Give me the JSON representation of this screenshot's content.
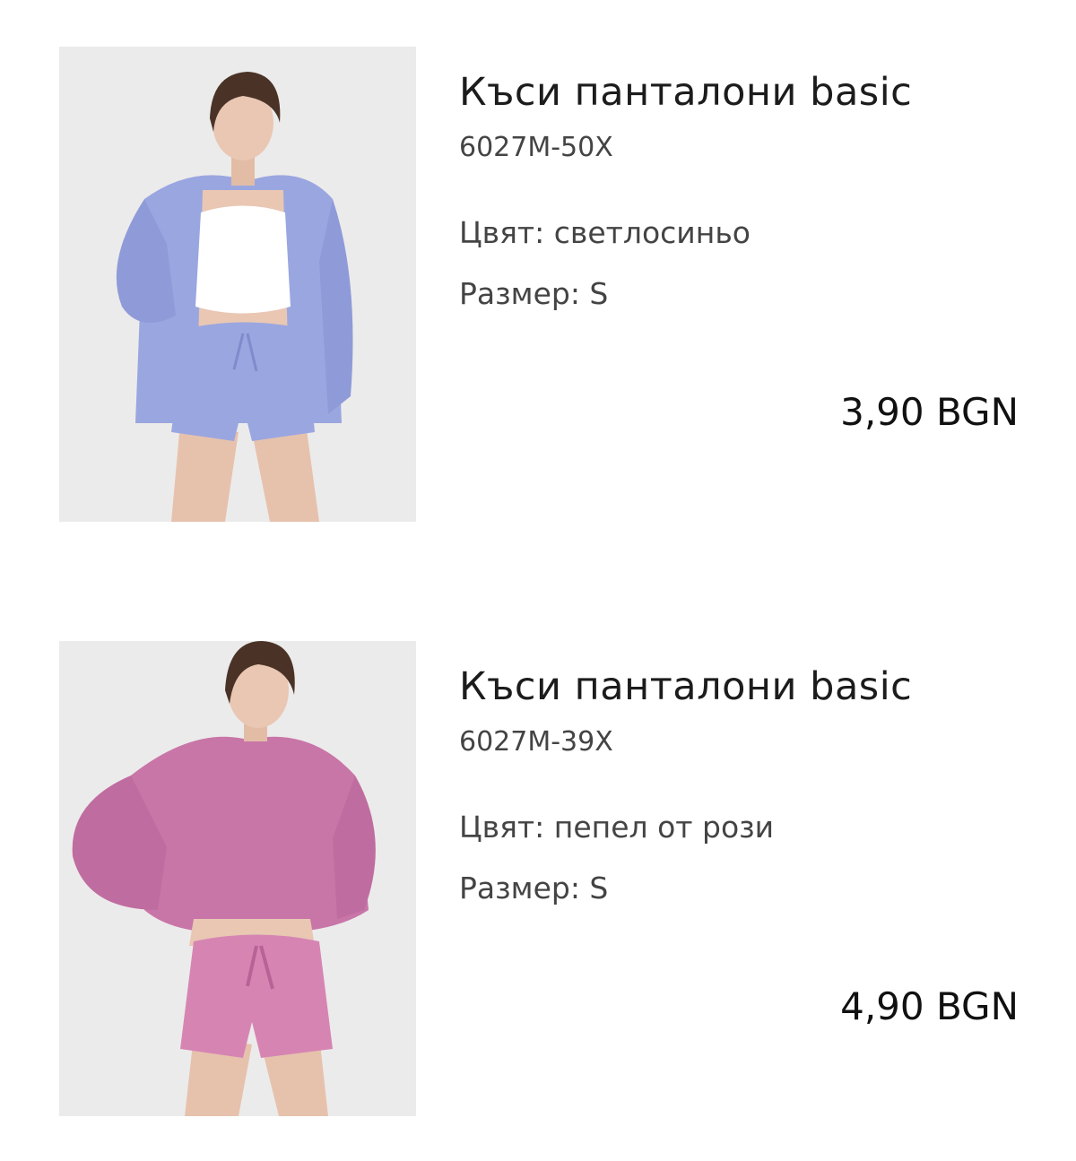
{
  "items": [
    {
      "title": "Къси панталони basic",
      "sku": "6027M-50X",
      "color_line": "Цвят: светлосиньо",
      "size_line": "Размер: S",
      "price": "3,90 BGN",
      "garment_color": "#9aa6e0"
    },
    {
      "title": "Къси панталони basic",
      "sku": "6027M-39X",
      "color_line": "Цвят: пепел от рози",
      "size_line": "Размер: S",
      "price": "4,90 BGN",
      "garment_color": "#c876a8"
    }
  ]
}
